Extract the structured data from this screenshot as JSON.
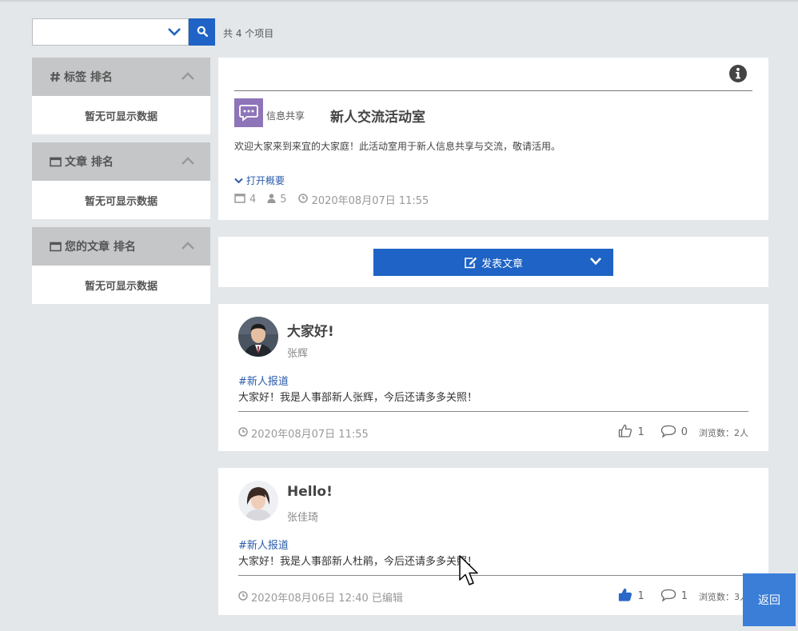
{
  "search": {
    "value": "",
    "count_text": "共 4 个项目"
  },
  "sidebar": {
    "panels": [
      {
        "title": "标签 排名",
        "empty_text": "暂无可显示数据"
      },
      {
        "title": "文章 排名",
        "empty_text": "暂无可显示数据"
      },
      {
        "title": "您的文章 排名",
        "empty_text": "暂无可显示数据"
      }
    ]
  },
  "room": {
    "category": "信息共享",
    "title": "新人交流活动室",
    "description": "欢迎大家来到来宜的大家庭！此活动室用于新人信息共享与交流，敬请活用。",
    "open_label": "打开概要",
    "articles_count": "4",
    "members_count": "5",
    "datetime": "2020年08月07日 11:55"
  },
  "post_button": {
    "label": "发表文章"
  },
  "articles": [
    {
      "title": "大家好!",
      "author": "张辉",
      "tag": "#新人报道",
      "body": "大家好！我是人事部新人张辉，今后还请多多关照！",
      "date": "2020年08月07日 11:55",
      "likes": "1",
      "comments": "0",
      "views": "浏览数：2人",
      "liked": false
    },
    {
      "title": "Hello!",
      "author": "张佳琦",
      "tag": "#新人报道",
      "body": "大家好！我是人事部新人杜鹃，今后还请多多关照！",
      "date": "2020年08月06日 12:40 已编辑",
      "likes": "1",
      "comments": "1",
      "views": "浏览数：3人",
      "liked": true
    }
  ],
  "back_button": {
    "label": "返回"
  },
  "colors": {
    "accent": "#1e63c5",
    "page_bg": "#e3e7ea",
    "sidebar_header": "#c4c6c8",
    "room_logo": "#8e74b8",
    "link": "#2a5caa",
    "back_button": "#3a7ed8"
  }
}
